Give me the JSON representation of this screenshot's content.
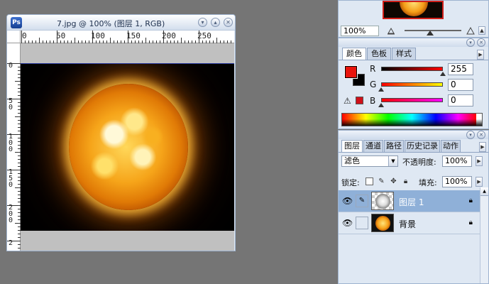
{
  "document": {
    "title": "7.jpg @ 100% (图层 1, RGB)",
    "app_icon": "photoshop-icon",
    "ruler_h_labels": [
      "0",
      "50",
      "100",
      "150",
      "200",
      "250"
    ],
    "ruler_v_labels": [
      "0",
      "5\n0",
      "1\n0\n0",
      "1\n5\n0",
      "2\n0\n0",
      "2"
    ]
  },
  "navigator": {
    "zoom": "100%"
  },
  "color_panel": {
    "tabs": [
      "颜色",
      "色板",
      "样式"
    ],
    "foreground": "#e8140c",
    "background": "#000000",
    "channels": [
      {
        "label": "R",
        "value": "255"
      },
      {
        "label": "G",
        "value": "0"
      },
      {
        "label": "B",
        "value": "0"
      }
    ],
    "gamut_warning_icon": "warning-icon"
  },
  "layers_panel": {
    "tabs": [
      "图层",
      "通道",
      "路径",
      "历史记录",
      "动作"
    ],
    "blend_mode": "滤色",
    "opacity_label": "不透明度:",
    "opacity_value": "100%",
    "lock_label": "锁定:",
    "fill_label": "填充:",
    "fill_value": "100%",
    "layers": [
      {
        "name": "图层 1",
        "selected": true
      },
      {
        "name": "背景",
        "selected": false
      }
    ]
  },
  "colors": {
    "desktop": "#757575",
    "panel": "#dfe8f3",
    "selection": "#8fb0d8",
    "accent_red": "#e8140c"
  }
}
